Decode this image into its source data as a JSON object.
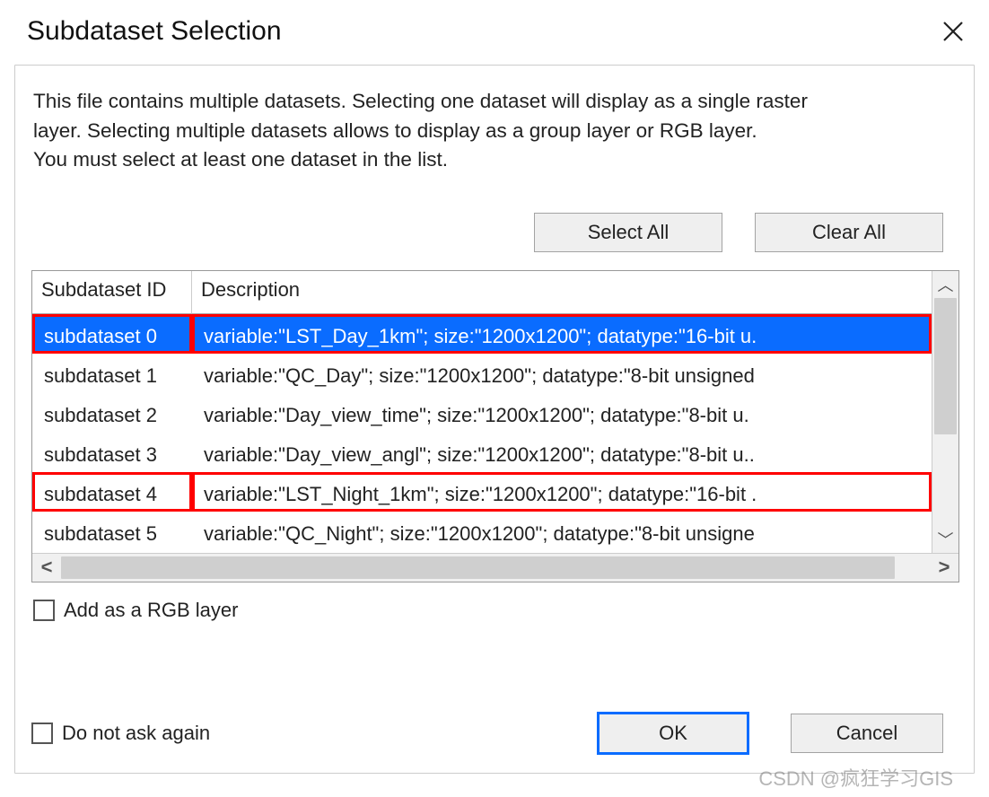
{
  "title": "Subdataset Selection",
  "intro_line1": "This file contains multiple datasets. Selecting one dataset will display as a single raster",
  "intro_line2": "layer. Selecting multiple datasets allows to display as a group layer or RGB layer.",
  "intro_line3": "You must select at least one dataset in the list.",
  "buttons": {
    "select_all": "Select All",
    "clear_all": "Clear All",
    "ok": "OK",
    "cancel": "Cancel"
  },
  "columns": {
    "id": "Subdataset ID",
    "desc": "Description"
  },
  "rows": [
    {
      "id": "subdataset 0",
      "desc": "variable:\"LST_Day_1km\"; size:\"1200x1200\"; datatype:\"16-bit u.",
      "selected": true,
      "red": true
    },
    {
      "id": "subdataset 1",
      "desc": "variable:\"QC_Day\"; size:\"1200x1200\"; datatype:\"8-bit unsigned",
      "selected": false,
      "red": false
    },
    {
      "id": "subdataset 2",
      "desc": "variable:\"Day_view_time\"; size:\"1200x1200\"; datatype:\"8-bit u.",
      "selected": false,
      "red": false
    },
    {
      "id": "subdataset 3",
      "desc": "variable:\"Day_view_angl\"; size:\"1200x1200\"; datatype:\"8-bit u..",
      "selected": false,
      "red": false
    },
    {
      "id": "subdataset 4",
      "desc": "variable:\"LST_Night_1km\"; size:\"1200x1200\"; datatype:\"16-bit .",
      "selected": false,
      "red": true
    },
    {
      "id": "subdataset 5",
      "desc": "variable:\"QC_Night\"; size:\"1200x1200\"; datatype:\"8-bit unsigne",
      "selected": false,
      "red": false
    }
  ],
  "checks": {
    "rgb_label": "Add as a RGB layer",
    "dont_ask_label": "Do not ask again"
  },
  "watermark": "CSDN @疯狂学习GIS"
}
